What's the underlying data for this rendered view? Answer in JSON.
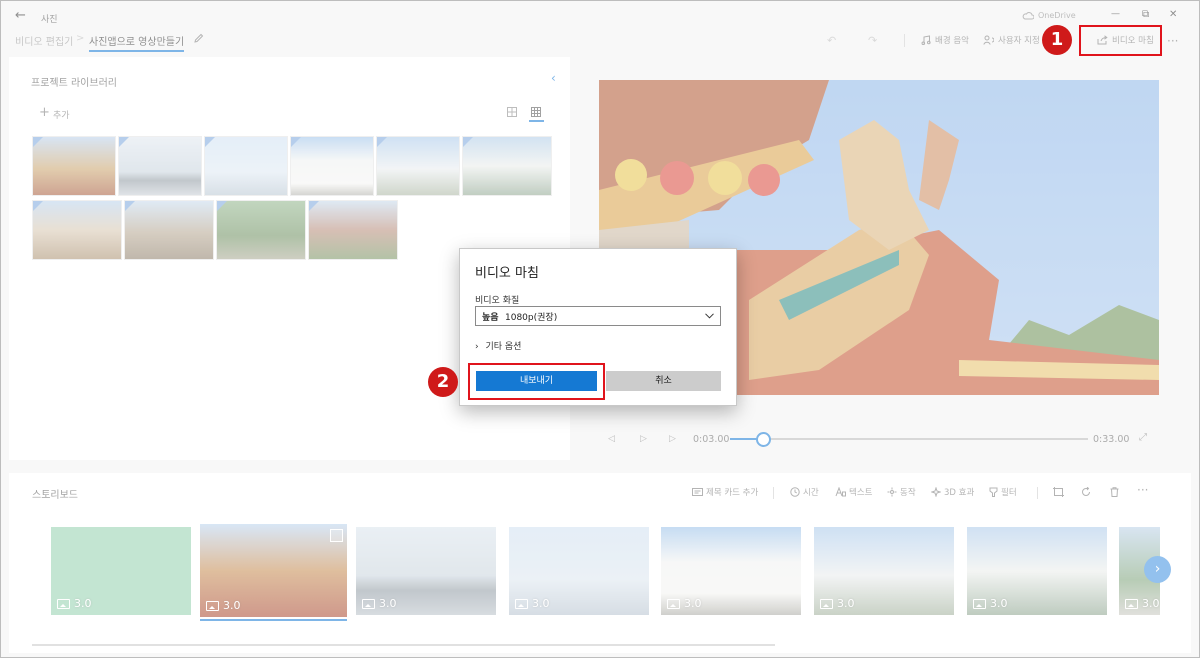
{
  "titlebar": {
    "back_icon": "←",
    "app_title": "사진",
    "cloud_label": "OneDrive",
    "minimize": "—",
    "restore": "⧉",
    "close": "✕"
  },
  "breadcrumb": {
    "parent": "비디오 편집기",
    "separator": ">",
    "current": "사진앱으로 영상만들기"
  },
  "toolbar": {
    "undo": "↶",
    "redo": "↷",
    "music_label": "배경 음악",
    "custom_label": "사용자 지정",
    "finish_label": "비디오 마침",
    "more": "···"
  },
  "library": {
    "title": "프로젝트 라이브러리",
    "add_label": "추가",
    "add_icon": "+"
  },
  "player": {
    "time_current": "0:03.00",
    "time_total": "0:33.00",
    "progress": 0.09
  },
  "storyboard": {
    "title": "스토리보드",
    "tools": {
      "title_card": "제목 카드 추가",
      "time": "시간",
      "text": "텍스트",
      "motion": "동작",
      "effects3d": "3D 효과",
      "filter": "필터",
      "more": "···"
    },
    "cards": [
      {
        "duration": "3.0",
        "kind": "title"
      },
      {
        "duration": "3.0",
        "kind": "temple"
      },
      {
        "duration": "3.0",
        "kind": "sea"
      },
      {
        "duration": "3.0",
        "kind": "sea2"
      },
      {
        "duration": "3.0",
        "kind": "building"
      },
      {
        "duration": "3.0",
        "kind": "building2"
      },
      {
        "duration": "3.0",
        "kind": "building3"
      },
      {
        "duration": "3.0",
        "kind": "tree"
      }
    ]
  },
  "dialog": {
    "title": "비디오 마침",
    "quality_label": "비디오 화질",
    "quality_value_bold": "높음",
    "quality_value": "1080p(권장)",
    "more_options": "기타 옵션",
    "export_label": "내보내기",
    "cancel_label": "취소"
  },
  "annotations": {
    "step1": "1",
    "step2": "2"
  },
  "colors": {
    "accent": "#1579d3",
    "highlight": "#e0141c",
    "badge": "#cf1a1a",
    "title_card": "#93cfae"
  }
}
